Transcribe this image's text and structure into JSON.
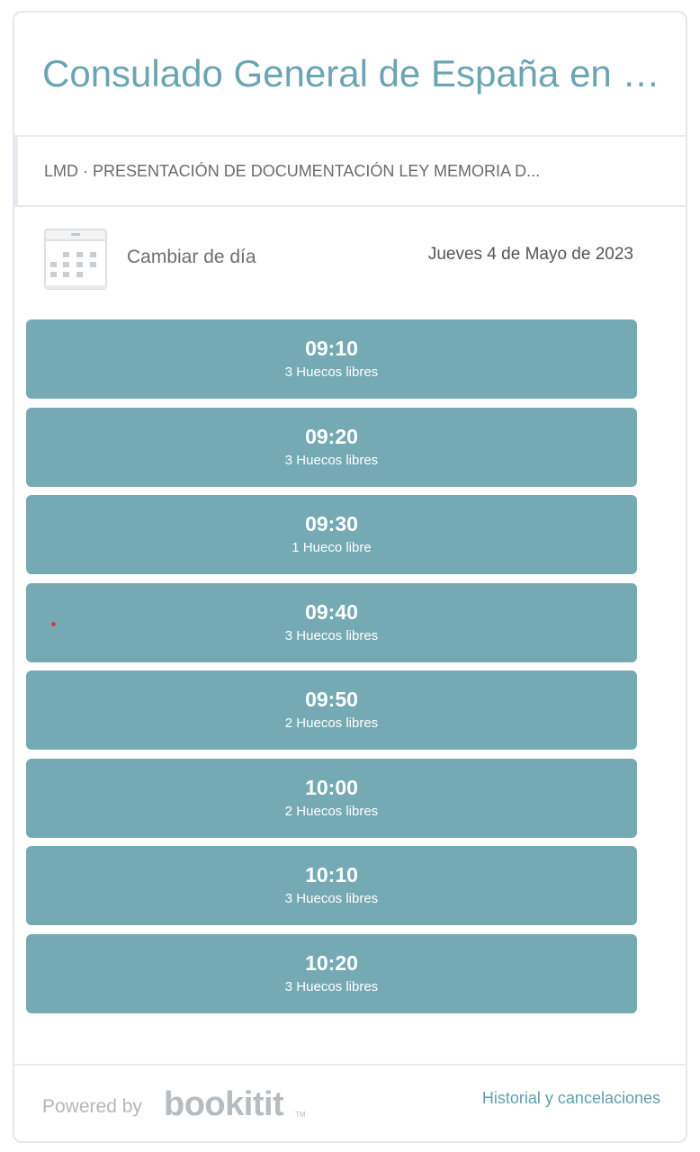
{
  "header": {
    "title": "Consulado General de España en L..."
  },
  "service": {
    "label": "LMD · PRESENTACIÓN DE DOCUMENTACIÓN LEY MEMORIA D..."
  },
  "day_selector": {
    "change_label": "Cambiar de día",
    "selected_date": "Jueves 4 de Mayo de 2023"
  },
  "slots": [
    {
      "time": "09:10",
      "availability": "3 Huecos libres"
    },
    {
      "time": "09:20",
      "availability": "3 Huecos libres"
    },
    {
      "time": "09:30",
      "availability": "1 Hueco libre"
    },
    {
      "time": "09:40",
      "availability": "3 Huecos libres"
    },
    {
      "time": "09:50",
      "availability": "2 Huecos libres"
    },
    {
      "time": "10:00",
      "availability": "2 Huecos libres"
    },
    {
      "time": "10:10",
      "availability": "3 Huecos libres"
    },
    {
      "time": "10:20",
      "availability": "3 Huecos libres"
    }
  ],
  "footer": {
    "powered_by": "Powered by",
    "brand": "bookitit",
    "trademark": "TM",
    "history_link": "Historial y cancelaciones"
  },
  "colors": {
    "accent": "#6aa5b3",
    "slot_background": "#75aab4",
    "link": "#5f9fb0"
  },
  "icons": {
    "calendar": "calendar-icon"
  }
}
